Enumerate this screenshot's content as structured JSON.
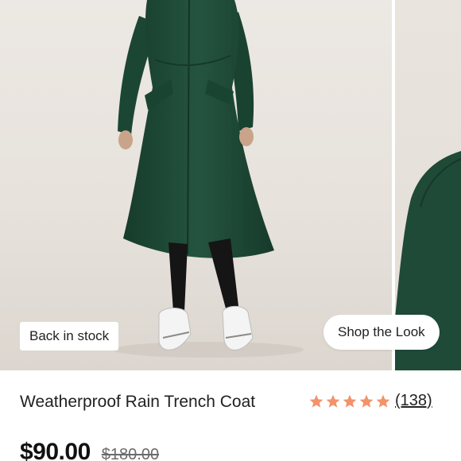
{
  "gallery": {
    "badge_label": "Back in stock",
    "shop_the_look_label": "Shop the Look",
    "main_image_alt": "Model wearing dark green rain trench coat",
    "coat_color": "#1f4a38"
  },
  "product": {
    "title": "Weatherproof Rain Trench Coat",
    "rating": 5,
    "review_count": "(138)",
    "price_sale": "$90.00",
    "price_original": "$180.00",
    "star_color": "#f2936b"
  }
}
